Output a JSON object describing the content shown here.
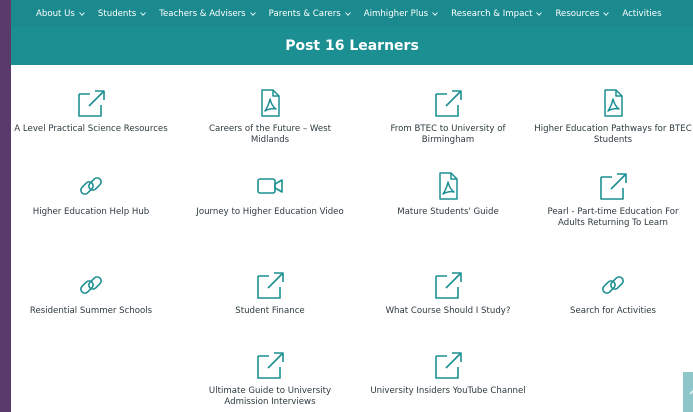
{
  "nav": {
    "items": [
      {
        "label": "About Us",
        "has_dropdown": true
      },
      {
        "label": "Students",
        "has_dropdown": true
      },
      {
        "label": "Teachers & Advisers",
        "has_dropdown": true
      },
      {
        "label": "Parents & Carers",
        "has_dropdown": true
      },
      {
        "label": "Aimhigher Plus",
        "has_dropdown": true
      },
      {
        "label": "Research & Impact",
        "has_dropdown": true
      },
      {
        "label": "Resources",
        "has_dropdown": true
      },
      {
        "label": "Activities",
        "has_dropdown": false
      }
    ]
  },
  "banner": {
    "title": "Post 16 Learners"
  },
  "resources": [
    {
      "label": "A Level Practical Science Resources",
      "icon": "external-link-icon"
    },
    {
      "label": "Careers of the Future – West Midlands",
      "icon": "pdf-icon"
    },
    {
      "label": "From BTEC to University of Birmingham",
      "icon": "external-link-icon"
    },
    {
      "label": "Higher Education Pathways for BTEC Students",
      "icon": "pdf-icon"
    },
    {
      "label": "Higher Education Help Hub",
      "icon": "link-icon"
    },
    {
      "label": "Journey to Higher Education Video",
      "icon": "video-icon"
    },
    {
      "label": "Mature Students' Guide",
      "icon": "pdf-icon"
    },
    {
      "label": "Pearl - Part-time Education For Adults Returning To Learn",
      "icon": "external-link-icon"
    },
    {
      "label": "Residential Summer Schools",
      "icon": "link-icon"
    },
    {
      "label": "Student Finance",
      "icon": "external-link-icon"
    },
    {
      "label": "What Course Should I Study?",
      "icon": "external-link-icon"
    },
    {
      "label": "Search for Activities",
      "icon": "link-icon"
    },
    {
      "label": "Ultimate Guide to University Admission Interviews",
      "icon": "external-link-icon"
    },
    {
      "label": "University Insiders YouTube Channel",
      "icon": "external-link-icon"
    }
  ],
  "colors": {
    "accent": "#1c8f93",
    "nav": "#1a8a8f",
    "side": "#5a3a6b",
    "text": "#2d3a3f"
  },
  "scroll_top": {
    "icon": "chevron-up-icon"
  }
}
